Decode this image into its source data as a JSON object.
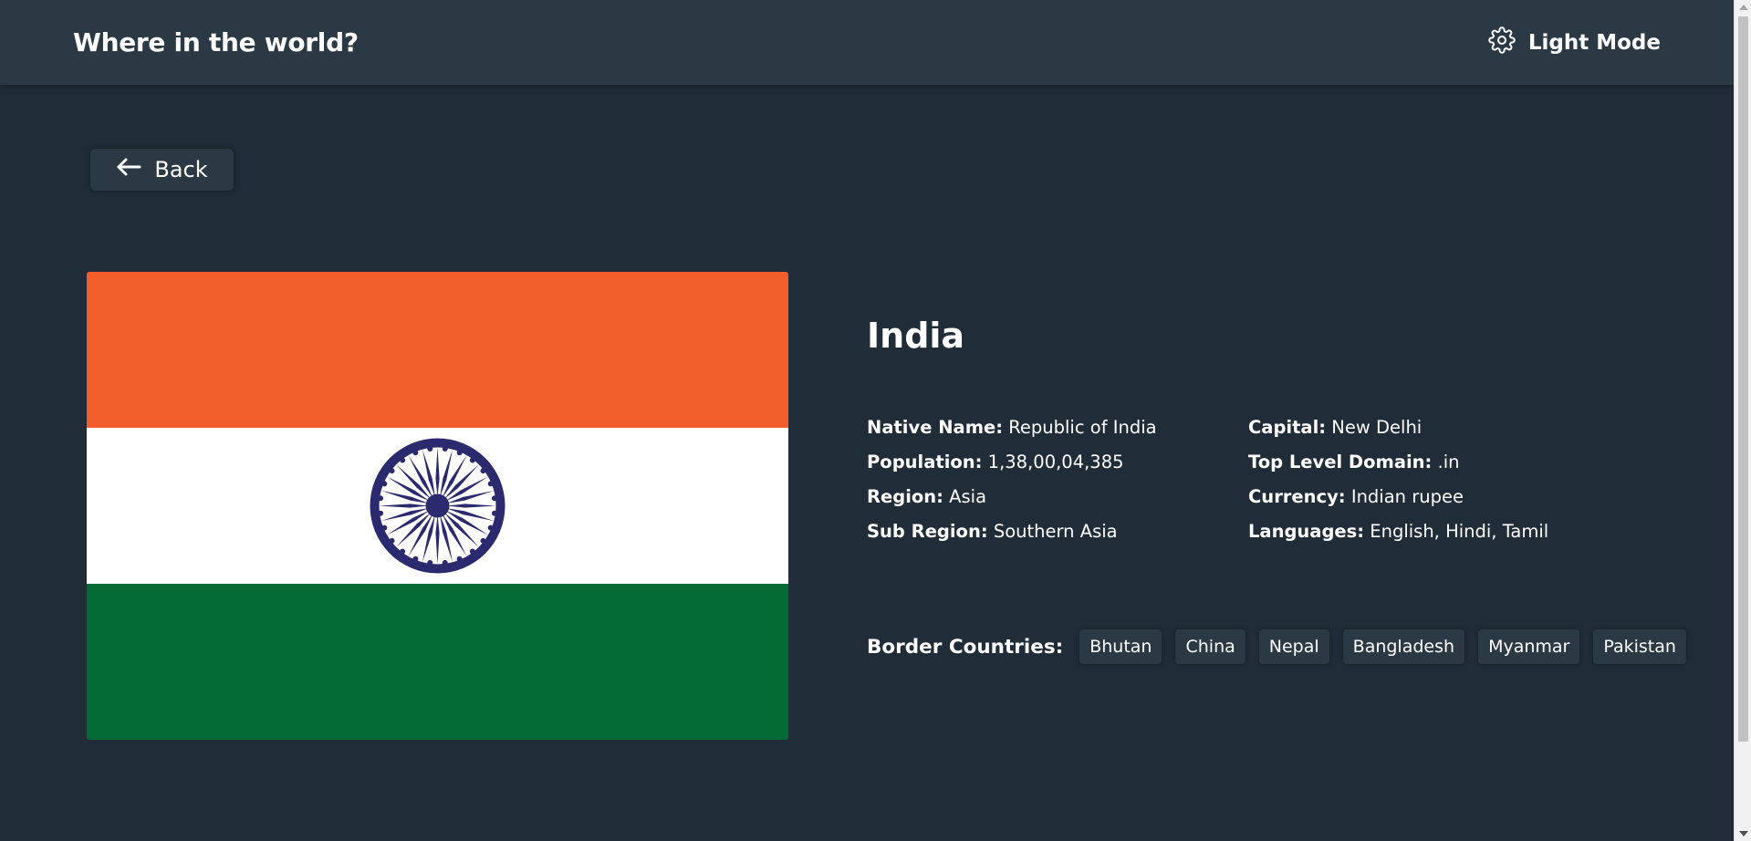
{
  "header": {
    "title": "Where in the world?",
    "theme_toggle_label": "Light Mode",
    "theme_icon": "gear-icon"
  },
  "back_button": {
    "label": "Back",
    "icon": "arrow-left-icon"
  },
  "country": {
    "name": "India",
    "flag_colors": {
      "saffron": "#f15e2b",
      "white": "#ffffff",
      "green": "#016a35",
      "chakra": "#2c2a6e"
    },
    "left_fields": [
      {
        "key": "Native Name:",
        "value": "Republic of India"
      },
      {
        "key": "Population:",
        "value": "1,38,00,04,385"
      },
      {
        "key": "Region:",
        "value": "Asia"
      },
      {
        "key": "Sub Region:",
        "value": "Southern Asia"
      }
    ],
    "right_fields": [
      {
        "key": "Capital:",
        "value": "New Delhi"
      },
      {
        "key": "Top Level Domain:",
        "value": ".in"
      },
      {
        "key": "Currency:",
        "value": "Indian rupee"
      },
      {
        "key": "Languages:",
        "value": "English, Hindi, Tamil"
      }
    ],
    "border_countries_label": "Border Countries:",
    "border_countries": [
      "Bhutan",
      "China",
      "Nepal",
      "Bangladesh",
      "Myanmar",
      "Pakistan"
    ]
  },
  "colors": {
    "background": "#202c37",
    "elements": "#2b3945",
    "text": "#ffffff"
  }
}
